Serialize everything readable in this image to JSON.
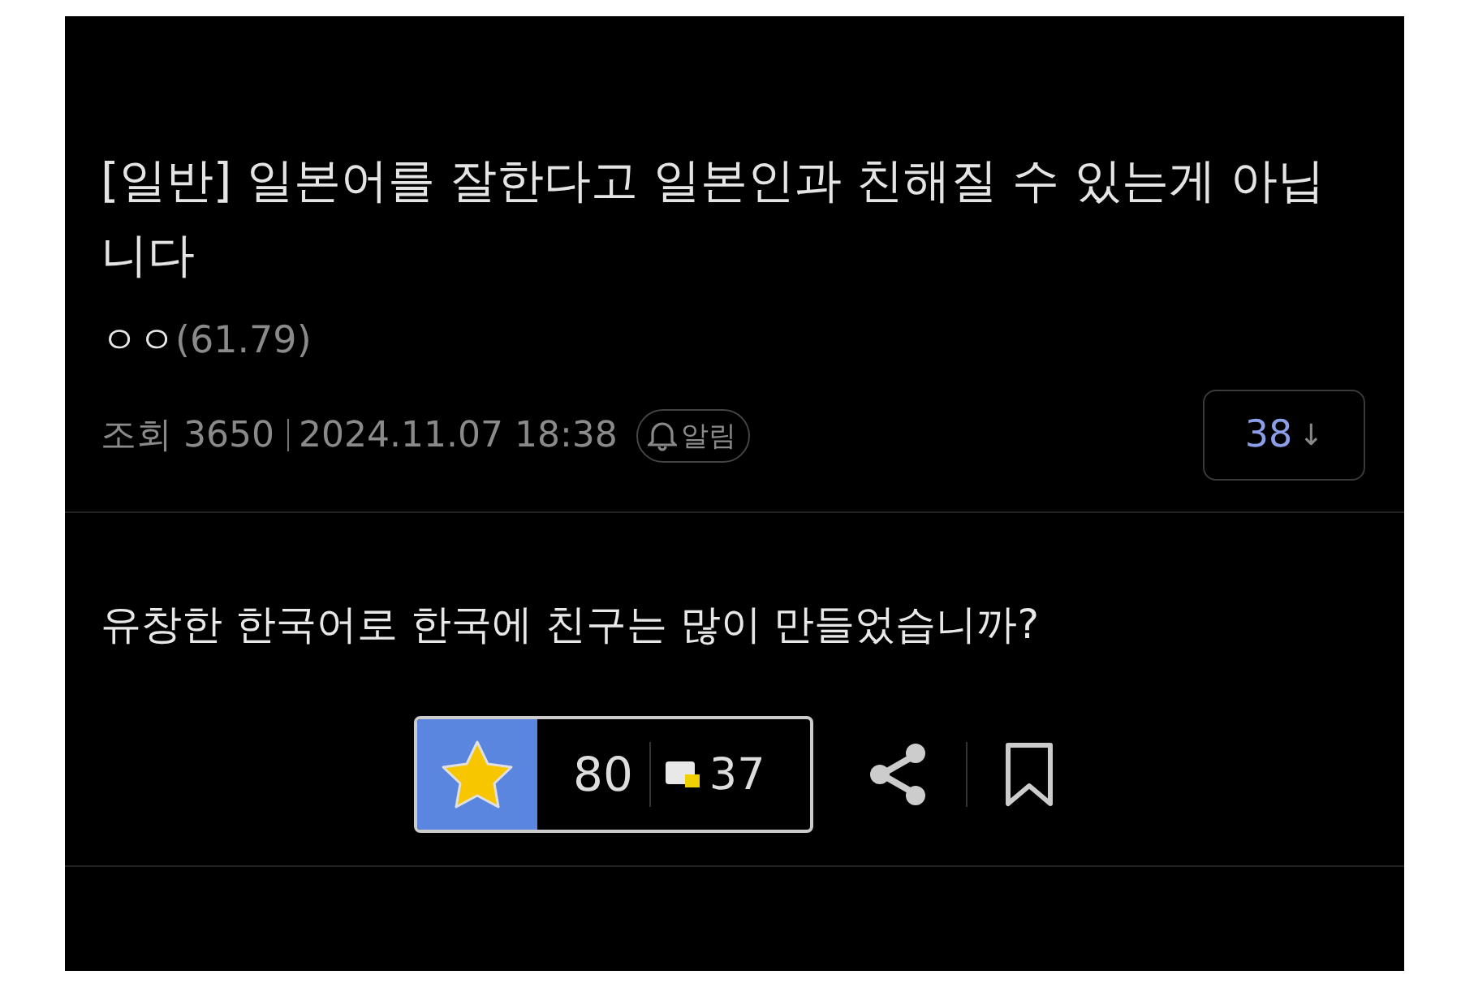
{
  "post": {
    "title": "[일반] 일본어를 잘한다고 일본인과 친해질 수 있는게 아닙니다",
    "author": "ㅇㅇ",
    "author_ip": "(61.79)",
    "views_label": "조회",
    "views": "3650",
    "date": "2024.11.07 18:38",
    "alert_label": "알림",
    "comment_jump": "38",
    "comment_jump_arrow": "↓",
    "body": "유창한 한국어로 한국에 친구는 많이 만들었습니까?",
    "recommend": {
      "count": "80",
      "active": true
    },
    "comments": "37"
  }
}
